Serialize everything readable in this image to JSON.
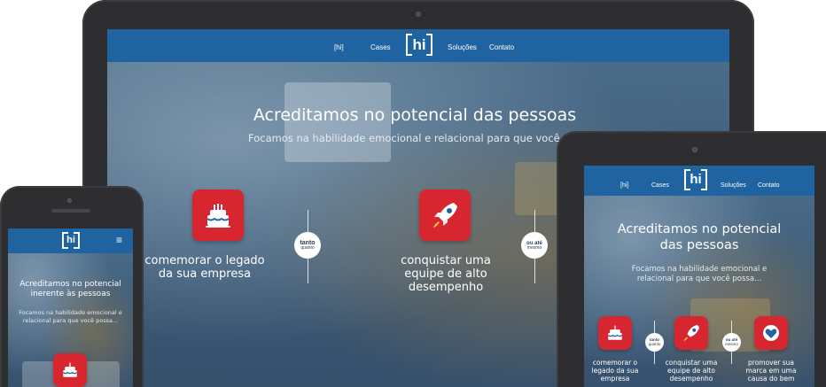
{
  "laptop": {
    "nav": {
      "item_hi": "[hi]",
      "cases": "Cases",
      "logo": "hi",
      "solucoes": "Soluções",
      "contato": "Contato"
    },
    "headline": "Acreditamos no potencial das pessoas",
    "subline": "Focamos na habilidade emocional e relacional para que você p",
    "features": [
      {
        "icon": "cake-icon",
        "text_line1": "comemorar o legado",
        "text_line2": "da sua empresa"
      },
      {
        "icon": "rocket-icon",
        "text_line1": "conquistar uma",
        "text_line2": "equipe de alto",
        "text_line3": "desempenho"
      }
    ],
    "connectors": [
      {
        "line1": "tanto",
        "line2": "quanto"
      },
      {
        "line1": "ou até",
        "line2": "mesmo"
      }
    ]
  },
  "tablet": {
    "nav": {
      "item_hi": "[hi]",
      "cases": "Cases",
      "logo": "hi",
      "solucoes": "Soluções",
      "contato": "Contato"
    },
    "headline_line1": "Acreditamos no potencial",
    "headline_line2": "das pessoas",
    "subline_line1": "Focamos na habilidade emocional e",
    "subline_line2": "relacional para que você possa...",
    "features": [
      {
        "icon": "cake-icon",
        "text_line1": "comemorar o",
        "text_line2": "legado da sua",
        "text_line3": "empresa"
      },
      {
        "icon": "rocket-icon",
        "text_line1": "conquistar uma",
        "text_line2": "equipe de alto",
        "text_line3": "desempenho"
      },
      {
        "icon": "heart-icon",
        "text_line1": "promover sua",
        "text_line2": "marca em uma",
        "text_line3": "causa do bem"
      }
    ],
    "connectors": [
      {
        "line1": "tanto",
        "line2": "quanto"
      },
      {
        "line1": "ou até",
        "line2": "mesmo"
      }
    ]
  },
  "phone": {
    "nav": {
      "logo": "hi",
      "menu_icon": "≡"
    },
    "headline_line1": "Acreditamos no potencial",
    "headline_line2": "inerente às pessoas",
    "subline_line1": "Focamos na habilidade emocional e",
    "subline_line2": "relacional para que você possa...",
    "feature_icon": "cake-icon"
  },
  "colors": {
    "navbar": "#1f64a0",
    "badge": "#d7262f",
    "device": "#2e2e30"
  }
}
